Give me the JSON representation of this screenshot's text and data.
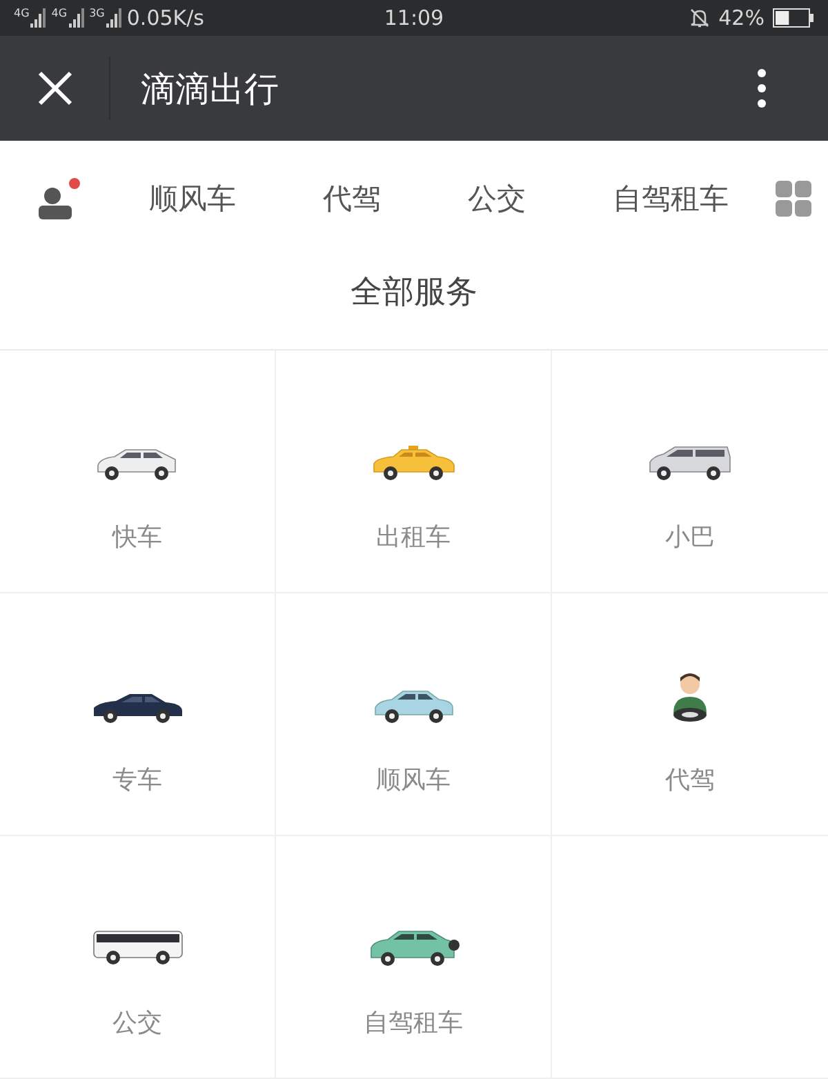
{
  "status_bar": {
    "networks": [
      "4G",
      "4G",
      "3G"
    ],
    "speed": "0.05K/s",
    "time": "11:09",
    "battery": {
      "reading": "42%",
      "level": 0.42
    }
  },
  "nav_bar": {
    "title": "滴滴出行"
  },
  "quick_tabs": {
    "profile_badge": true,
    "tabs": [
      "顺风车",
      "代驾",
      "公交",
      "自驾租车"
    ]
  },
  "section_title": "全部服务",
  "services": [
    {
      "label": "快车",
      "kind": "hatchback"
    },
    {
      "label": "出租车",
      "kind": "taxi"
    },
    {
      "label": "小巴",
      "kind": "minivan"
    },
    {
      "label": "专车",
      "kind": "sedan"
    },
    {
      "label": "顺风车",
      "kind": "compact"
    },
    {
      "label": "代驾",
      "kind": "driver"
    },
    {
      "label": "公交",
      "kind": "bus"
    },
    {
      "label": "自驾租车",
      "kind": "suv"
    }
  ]
}
